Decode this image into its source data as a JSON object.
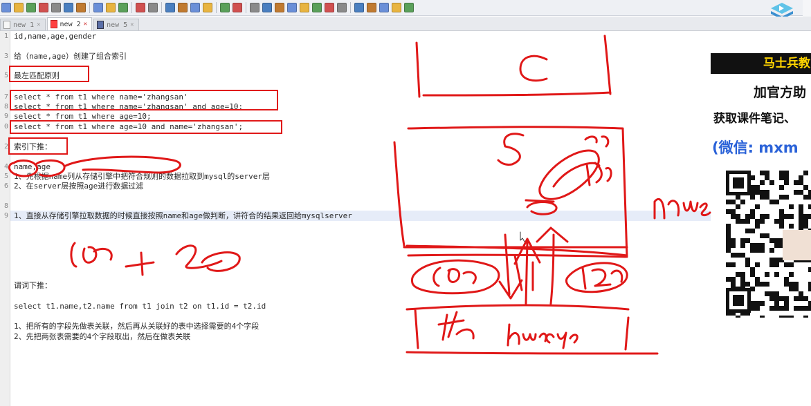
{
  "tabs": [
    {
      "label": "new 1"
    },
    {
      "label": "new 2"
    },
    {
      "label": "new 5"
    }
  ],
  "editor_lines": [
    {
      "n": "1",
      "text": "id,name,age,gender"
    },
    {
      "n": "3",
      "text": "给（name,age）创建了组合索引"
    },
    {
      "n": "5",
      "text": "最左匹配原则"
    },
    {
      "n": "7",
      "text": "select * from t1 where name='zhangsan'"
    },
    {
      "n": "8",
      "text": "select * from t1 where name='zhangsan' and age=10;"
    },
    {
      "n": "9",
      "text": "select * from t1 where age=10;"
    },
    {
      "n": "0",
      "text": "select * from t1 where age=10 and name='zhangsan';"
    },
    {
      "n": "2",
      "text": "索引下推："
    },
    {
      "n": "4",
      "text": "name,age"
    },
    {
      "n": "5",
      "text": "1、先根据name列从存储引擎中把符合规则的数据拉取到mysql的server层"
    },
    {
      "n": "6",
      "text": "2、在server层按照age进行数据过滤"
    },
    {
      "n": "8",
      "text": ""
    },
    {
      "n": "9",
      "text": "1、直接从存储引擎拉取数据的时候直接按照name和age做判断，讲符合的结果返回给mysqlserver"
    },
    {
      "n": "",
      "text": "谓词下推："
    },
    {
      "n": "",
      "text": "select t1.name,t2.name from t1 join t2 on t1.id = t2.id"
    },
    {
      "n": "",
      "text": "1、把所有的字段先做表关联，然后再从关联好的表中选择需要的4个字段"
    },
    {
      "n": "",
      "text": "2、先把两张表需要的4个字段取出，然后在做表关联"
    }
  ],
  "ad": {
    "header": "马士兵教",
    "line1": "加官方助",
    "line2": "获取课件笔记、",
    "line3": "(微信: mxm"
  },
  "toolbar_icons": [
    "new-file",
    "open-file",
    "save",
    "save-all",
    "close",
    "close-all",
    "print",
    "cut",
    "copy",
    "paste",
    "undo",
    "redo",
    "find",
    "replace",
    "zoom-in",
    "zoom-out",
    "sync-v",
    "sync-h",
    "word-wrap",
    "all-chars",
    "indent-guide",
    "udl",
    "doc-map",
    "function-list",
    "folder-workspace",
    "monitor",
    "record-macro",
    "stop-macro",
    "play-macro",
    "run-macro-multiple",
    "save-macro"
  ],
  "colors": {
    "annotation": "#e01818",
    "highlight_row": "#e6ecf8",
    "ad_accent": "#ffd400",
    "wechat_blue": "#2a62d8"
  }
}
